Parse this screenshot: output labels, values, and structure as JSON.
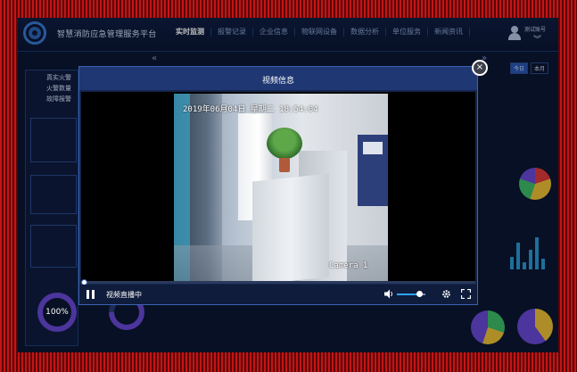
{
  "header": {
    "app_title": "智慧消防应急管理服务平台",
    "nav": [
      "实时监测",
      "报警记录",
      "企业信息",
      "物联网设备",
      "数据分析",
      "单位服务",
      "新闻资讯"
    ],
    "active_nav": "实时监测",
    "user": "测试账号"
  },
  "left_panel": {
    "alerts": [
      "真实火警",
      "火警数量",
      "故障报警"
    ],
    "gauge_value": "100%"
  },
  "right_panel": {
    "tabs": [
      "今日",
      "本月"
    ],
    "active_tab": "今日"
  },
  "modal": {
    "title": "视频信息",
    "close_icon": "close-icon",
    "video": {
      "timestamp_overlay": "2019年06月04日 星期二 18:54:04",
      "camera_label": "Camera 1",
      "status": "视频直播中",
      "progress": 0.0,
      "volume": 0.8
    },
    "controls": {
      "pause_icon": "pause-icon",
      "volume_icon": "volume-icon",
      "settings_icon": "gear-icon",
      "fullscreen_icon": "fullscreen-icon"
    }
  },
  "colors": {
    "page_border": "#c41515",
    "panel_bg": "#0b1733",
    "modal_header": "#1f3873",
    "accent": "#2fa3ff"
  }
}
